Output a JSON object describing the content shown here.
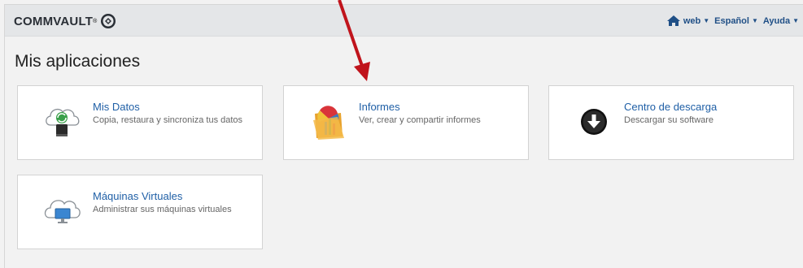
{
  "header": {
    "logo_text": "COMMVAULT",
    "logo_tm": "®",
    "nav": [
      {
        "label": "web"
      },
      {
        "label": "Español"
      },
      {
        "label": "Ayuda"
      }
    ]
  },
  "page": {
    "title": "Mis aplicaciones"
  },
  "apps": [
    {
      "title": "Mis Datos",
      "description": "Copia, restaura y sincroniza tus datos",
      "icon": "cloud-sync-drive-icon"
    },
    {
      "title": "Informes",
      "description": "Ver, crear y compartir informes",
      "icon": "reports-folder-icon"
    },
    {
      "title": "Centro de descarga",
      "description": "Descargar su software",
      "icon": "download-icon"
    },
    {
      "title": "Máquinas Virtuales",
      "description": "Administrar sus máquinas virtuales",
      "icon": "cloud-monitor-icon"
    }
  ],
  "colors": {
    "link": "#1f5fa6",
    "nav": "#1f4f86",
    "annotation_arrow": "#c0141c"
  }
}
